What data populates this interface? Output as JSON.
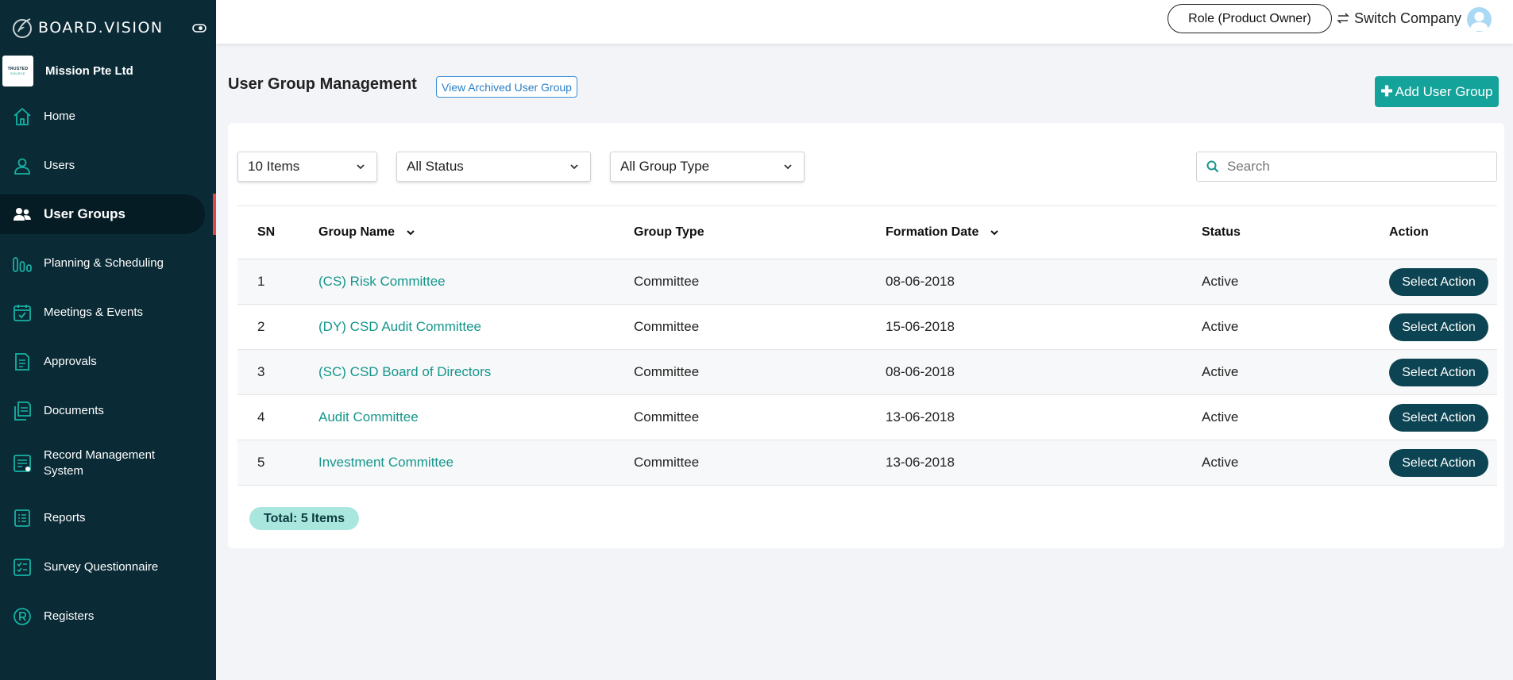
{
  "app": {
    "logo_text": "BOARD.VISION",
    "company_logo_line1": "TRUSTED",
    "company_logo_line2": "SOURCE",
    "company_name": "Mission Pte Ltd"
  },
  "sidebar": {
    "items": [
      {
        "label": "Home",
        "icon": "home-icon"
      },
      {
        "label": "Users",
        "icon": "user-icon"
      },
      {
        "label": "User Groups",
        "icon": "user-group-icon",
        "active": true
      },
      {
        "label": "Planning & Scheduling",
        "icon": "bar-chart-icon"
      },
      {
        "label": "Meetings & Events",
        "icon": "calendar-check-icon"
      },
      {
        "label": "Approvals",
        "icon": "approval-document-icon"
      },
      {
        "label": "Documents",
        "icon": "documents-icon"
      },
      {
        "label": "Record Management System",
        "icon": "record-management-icon"
      },
      {
        "label": "Reports",
        "icon": "report-list-icon"
      },
      {
        "label": "Survey Questionnaire",
        "icon": "survey-icon"
      },
      {
        "label": "Registers",
        "icon": "registered-icon"
      }
    ]
  },
  "header": {
    "role_label": "Role (Product Owner)",
    "switch_company_label": "Switch Company"
  },
  "page": {
    "title": "User Group Management",
    "archived_button": "View Archived User Group",
    "add_button": "Add User Group"
  },
  "filters": {
    "items_per_page": "10 Items",
    "status": "All Status",
    "group_type": "All Group Type",
    "search_placeholder": "Search"
  },
  "table": {
    "columns": [
      "SN",
      "Group Name",
      "Group Type",
      "Formation Date",
      "Status",
      "Action"
    ],
    "rows": [
      {
        "sn": "1",
        "name": "(CS) Risk Committee",
        "type": "Committee",
        "date": "08-06-2018",
        "status": "Active",
        "action": "Select Action"
      },
      {
        "sn": "2",
        "name": "(DY) CSD Audit Committee",
        "type": "Committee",
        "date": "15-06-2018",
        "status": "Active",
        "action": "Select Action"
      },
      {
        "sn": "3",
        "name": "(SC) CSD Board of Directors",
        "type": "Committee",
        "date": "08-06-2018",
        "status": "Active",
        "action": "Select Action"
      },
      {
        "sn": "4",
        "name": "Audit Committee",
        "type": "Committee",
        "date": "13-06-2018",
        "status": "Active",
        "action": "Select Action"
      },
      {
        "sn": "5",
        "name": "Investment Committee",
        "type": "Committee",
        "date": "13-06-2018",
        "status": "Active",
        "action": "Select Action"
      }
    ],
    "total_label": "Total: 5 Items"
  },
  "colors": {
    "sidebar_bg": "#0a2a35",
    "accent_teal": "#14a39a",
    "action_button": "#0d4453",
    "active_marker": "#e04848",
    "link": "#14968c"
  }
}
